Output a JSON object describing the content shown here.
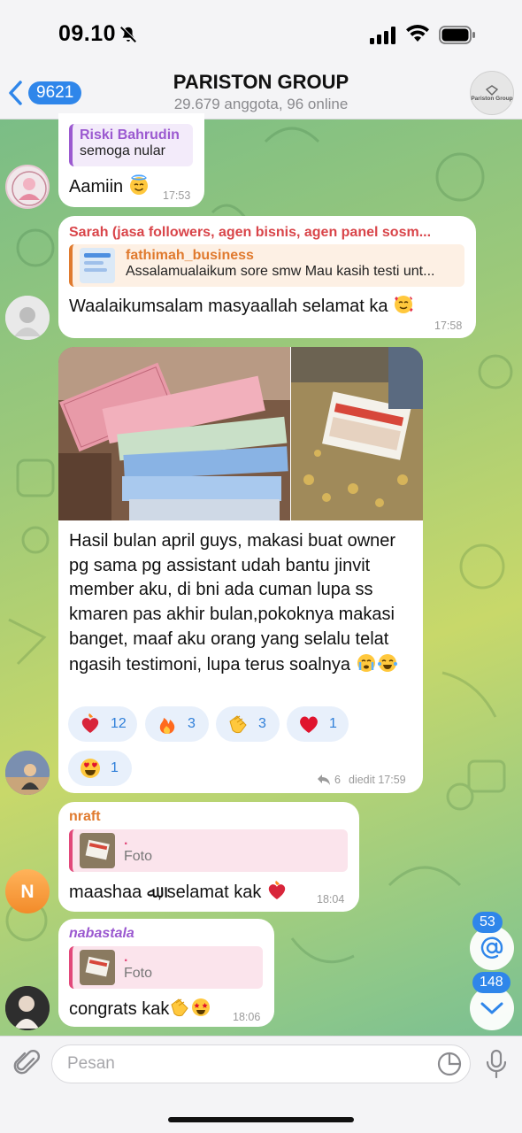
{
  "status_bar": {
    "time": "09.10"
  },
  "header": {
    "back_count": "9621",
    "title": "PARISTON GROUP",
    "subtitle": "29.679 anggota, 96 online",
    "avatar_text": "Pariston Group"
  },
  "messages": {
    "m1": {
      "reply_name": "Riski Bahrudin",
      "reply_text": "semoga nular",
      "text": "Aamiin",
      "time": "17:53"
    },
    "m2": {
      "sender": "Sarah (jasa followers, agen bisnis, agen panel sosm...",
      "reply_name": "fathimah_business",
      "reply_text": "Assalamualaikum sore smw Mau kasih testi unt...",
      "text": "Waalaikumsalam masyaallah selamat ka",
      "time": "17:58"
    },
    "m3": {
      "text": "Hasil bulan april guys, makasi buat owner pg sama pg assistant udah bantu jinvit member aku, di bni ada cuman lupa ss kmaren pas akhir bulan,pokoknya makasi banget, maaf aku orang yang selalu telat ngasih testimoni, lupa terus soalnya",
      "reactions": [
        {
          "icon": "heart-on-fire-icon",
          "count": "12"
        },
        {
          "icon": "fire-icon",
          "count": "3"
        },
        {
          "icon": "clapping-hands-icon",
          "count": "3"
        },
        {
          "icon": "red-heart-icon",
          "count": "1"
        },
        {
          "icon": "heart-eyes-icon",
          "count": "1"
        }
      ],
      "replies": "6",
      "meta": "diedit 17:59"
    },
    "m4": {
      "sender": "nraft",
      "reply_name": ".",
      "reply_text": "Foto",
      "text": "maashaa ﷲ, selamat kak",
      "time": "18:04",
      "avatar_letter": "N"
    },
    "m5": {
      "sender": "nabastala",
      "reply_name": ".",
      "reply_text": "Foto",
      "text": "congrats kak",
      "time": "18:06"
    }
  },
  "fabs": {
    "mentions": "53",
    "unread": "148"
  },
  "input": {
    "placeholder": "Pesan"
  },
  "colors": {
    "accent": "#2f86ea",
    "wallpaper_green": "#9cc97a"
  }
}
